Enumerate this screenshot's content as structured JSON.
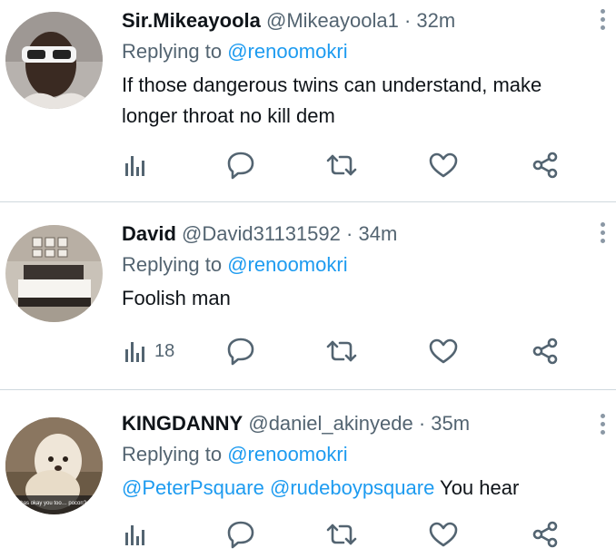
{
  "tweets": [
    {
      "name": "Sir.Mikeayoola",
      "handle": "@Mikeayoola1",
      "separator": "·",
      "time": "32m",
      "replying_label": "Replying to",
      "replying_to": "@renoomokri",
      "body_lines": [
        "If those dangerous twins can understand, make",
        "longer throat no kill dem"
      ],
      "views_count": ""
    },
    {
      "name": "David",
      "handle": "@David31131592",
      "separator": "·",
      "time": "34m",
      "replying_label": "Replying to",
      "replying_to": "@renoomokri",
      "body": "Foolish man",
      "views_count": "18"
    },
    {
      "name": "KINGDANNY",
      "handle": "@daniel_akinyede",
      "separator": "·",
      "time": "35m",
      "replying_label": "Replying to",
      "replying_to": "@renoomokri",
      "body_mention_1": "@PeterPsquare",
      "body_mention_2": "@rudeboypsquare",
      "body_text": "You hear",
      "avatar_caption": "rty has okay you too… pocon? 8"
    }
  ],
  "colors": {
    "text": "#0f1419",
    "secondary": "#536471",
    "link": "#1d9bf0",
    "divider": "#cfd9de"
  },
  "icons": [
    "views-icon",
    "reply-icon",
    "retweet-icon",
    "like-icon",
    "share-icon",
    "more-icon"
  ]
}
